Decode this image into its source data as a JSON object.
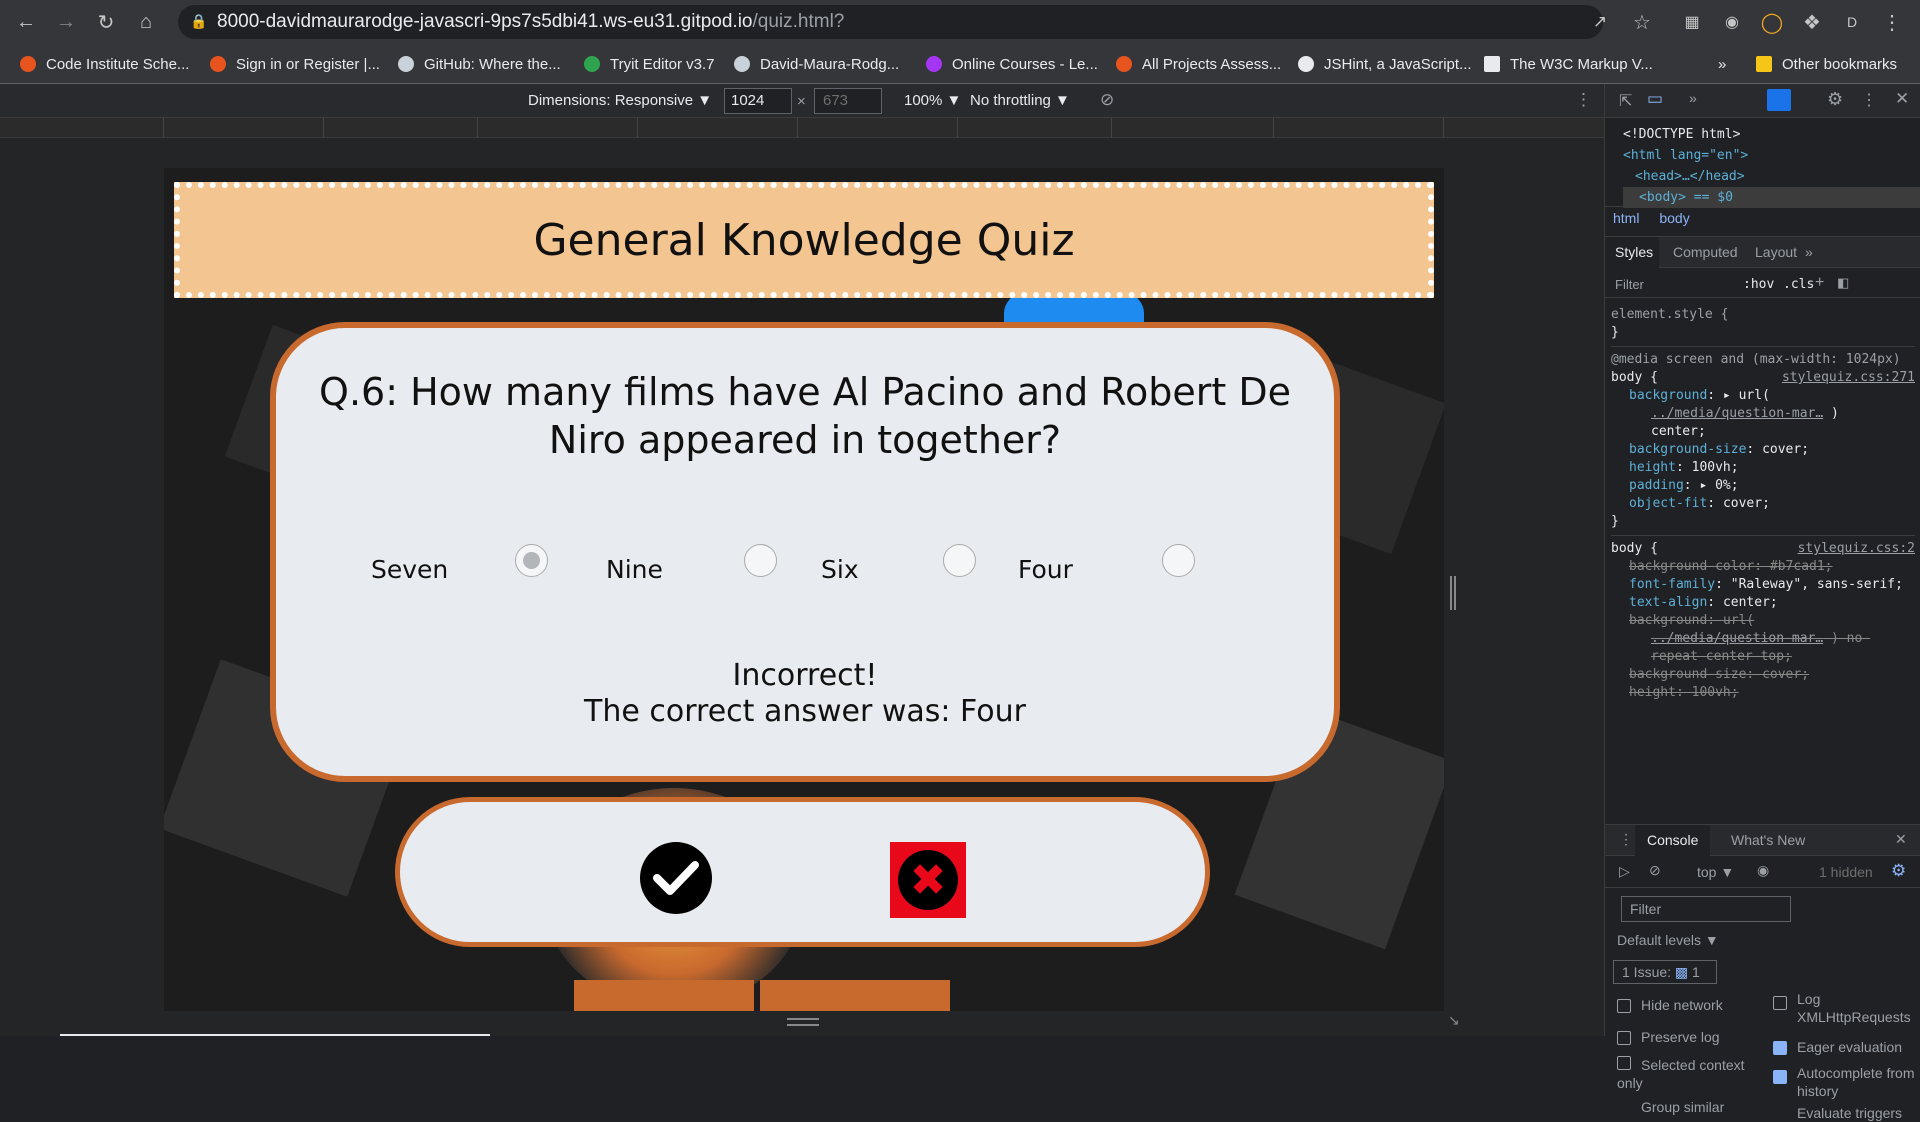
{
  "browser": {
    "url_main": "8000-davidmaurarodge-javascri-9ps7s5dbi41.ws-eu31.gitpod.io",
    "url_path": "/quiz.html?",
    "profile_initial": "D",
    "bookmarks": [
      {
        "label": "Code Institute Sche...",
        "color": "#e8541e"
      },
      {
        "label": "Sign in or Register |...",
        "color": "#e8541e"
      },
      {
        "label": "GitHub: Where the...",
        "color": "#c9d1d9"
      },
      {
        "label": "Tryit Editor v3.7",
        "color": "#2ea44f"
      },
      {
        "label": "David-Maura-Rodg...",
        "color": "#c9d1d9"
      },
      {
        "label": "Online Courses - Le...",
        "color": "#a435f0"
      },
      {
        "label": "All Projects Assess...",
        "color": "#e8541e"
      },
      {
        "label": "JSHint, a JavaScript...",
        "color": "#e8eaed"
      },
      {
        "label": "The W3C Markup V...",
        "color": "#e8eaed"
      }
    ],
    "overflow": "»",
    "other_bookmarks": "Other bookmarks"
  },
  "device_toolbar": {
    "dimensions_label": "Dimensions: Responsive ▼",
    "width": "1024",
    "times": "×",
    "height_placeholder": "673",
    "zoom": "100% ▼",
    "throttling": "No throttling ▼"
  },
  "quiz": {
    "title": "General Knowledge Quiz",
    "question": "Q.6: How many films have Al Pacino and Robert De Niro appeared in together?",
    "options": [
      "Seven",
      "Nine",
      "Six",
      "Four"
    ],
    "selected_index": 0,
    "feedback_line1": "Incorrect!",
    "feedback_line2": "The correct answer was: Four"
  },
  "devtools": {
    "dom": {
      "doctype": "<!DOCTYPE html>",
      "html_open": "<html lang=\"en\">",
      "head": "<head>…</head>",
      "body": "<body> == $0"
    },
    "breadcrumb": [
      "html",
      "body"
    ],
    "tabs": [
      "Styles",
      "Computed",
      "Layout",
      "»"
    ],
    "filter_placeholder": "Filter",
    "hov": ":hov",
    "cls": ".cls",
    "rules": {
      "element_style": "element.style {",
      "close": "}",
      "media": "@media screen and (max-width: 1024px)",
      "body_sel": "body {",
      "source1": "stylequiz.css:271",
      "source2": "stylequiz.css:2",
      "bg_prop": "background",
      "bg_val": "url(",
      "bg_link": "../media/question-mar…",
      "bg_end": ")",
      "center": "center;",
      "bgsize_prop": "background-size",
      "bgsize_val": "cover;",
      "height_prop": "height",
      "height_val": "100vh;",
      "padding_prop": "padding",
      "padding_val": "0%;",
      "objfit_prop": "object-fit",
      "objfit_val": "cover;",
      "bgcolor_prop": "background-color",
      "bgcolor_val": "#b7cad1;",
      "font_prop": "font-family",
      "font_val": "\"Raleway\", sans-serif;",
      "align_prop": "text-align",
      "align_val": "center;",
      "norepeat": "repeat center top;",
      "norepeat_pre": ") no-",
      "height_val2": "100vh;"
    },
    "console": {
      "tabs": [
        "Console",
        "What's New"
      ],
      "context": "top ▼",
      "hidden": "1 hidden",
      "filter_placeholder": "Filter",
      "levels": "Default levels ▼",
      "issues": "1 Issue:",
      "issue_count": "1",
      "settings": [
        {
          "label": "Hide network",
          "checked": false
        },
        {
          "label": "Log XMLHttpRequests",
          "checked": false
        },
        {
          "label": "Preserve log",
          "checked": false
        },
        {
          "label": "Eager evaluation",
          "checked": true
        },
        {
          "label": "Selected context only",
          "checked": false
        },
        {
          "label": "Autocomplete from history",
          "checked": true
        },
        {
          "label": "Group similar",
          "checked": false
        },
        {
          "label": "Evaluate triggers",
          "checked": false
        }
      ]
    }
  }
}
